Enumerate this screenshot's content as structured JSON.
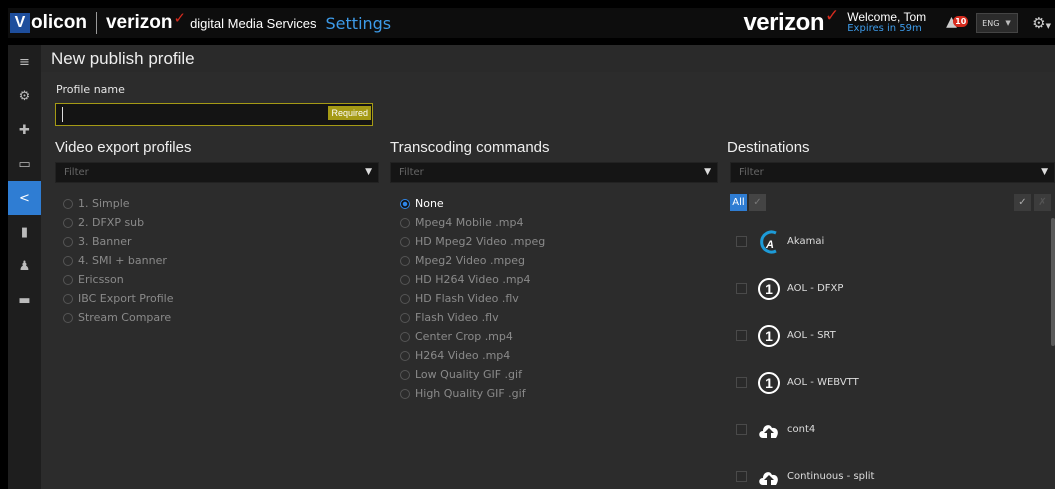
{
  "topbar": {
    "logo_v": "V",
    "logo_text": "olicon",
    "verizon_small": "verizon",
    "checkmark": "✓",
    "dms": "digital Media Services",
    "settings": "Settings",
    "verizon_big": "verizon",
    "welcome": "Welcome, Tom",
    "expires": "Expires in 59m",
    "notification_count": "10",
    "language": "ENG"
  },
  "sidebar": {
    "items": [
      {
        "name": "menu-icon",
        "glyph": "≡"
      },
      {
        "name": "gear-icon",
        "glyph": "⚙"
      },
      {
        "name": "puzzle-icon",
        "glyph": "✚"
      },
      {
        "name": "monitor-icon",
        "glyph": "▭"
      },
      {
        "name": "share-icon",
        "glyph": "<",
        "active": true
      },
      {
        "name": "clipboard-icon",
        "glyph": "▮"
      },
      {
        "name": "user-icon",
        "glyph": "♟"
      },
      {
        "name": "card-icon",
        "glyph": "▬"
      }
    ]
  },
  "page": {
    "title": "New publish profile",
    "profile_name_label": "Profile name",
    "profile_name_value": "",
    "required": "Required"
  },
  "video_export": {
    "title": "Video export profiles",
    "filter_placeholder": "Filter",
    "options": [
      "1. Simple",
      "2. DFXP sub",
      "3. Banner",
      "4. SMI + banner",
      "Ericsson",
      "IBC Export Profile",
      "Stream Compare"
    ]
  },
  "transcoding": {
    "title": "Transcoding commands",
    "filter_placeholder": "Filter",
    "selected": "None",
    "options": [
      "None",
      "Mpeg4 Mobile .mp4",
      "HD Mpeg2 Video .mpeg",
      "Mpeg2 Video .mpeg",
      "HD H264 Video .mp4",
      "HD Flash Video .flv",
      "Flash Video .flv",
      "Center Crop .mp4",
      "H264 Video .mp4",
      "Low Quality GIF .gif",
      "High Quality GIF .gif"
    ]
  },
  "destinations": {
    "title": "Destinations",
    "filter_placeholder": "Filter",
    "all_label": "All",
    "items": [
      {
        "label": "Akamai",
        "icon": "akamai-icon"
      },
      {
        "label": "AOL - DFXP",
        "icon": "aol-icon"
      },
      {
        "label": "AOL - SRT",
        "icon": "aol-icon"
      },
      {
        "label": "AOL - WEBVTT",
        "icon": "aol-icon"
      },
      {
        "label": "cont4",
        "icon": "cloud-upload-icon"
      },
      {
        "label": "Continuous - split",
        "icon": "cloud-upload-icon"
      }
    ]
  },
  "colors": {
    "accent": "#2f7dd3",
    "link": "#3d9be9",
    "required": "#a59a15",
    "brand_red": "#d52b1e"
  }
}
